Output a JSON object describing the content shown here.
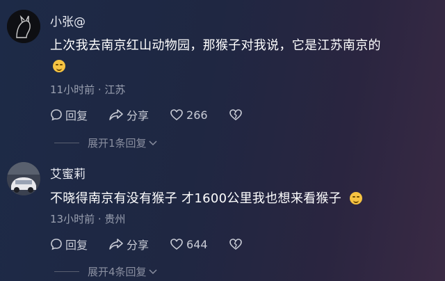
{
  "comments": [
    {
      "username": "小张@",
      "text": "上次我去南京红山动物园，那猴子对我说，它是江苏南京的",
      "time_location": "11小时前 · 江苏",
      "reply_label": "回复",
      "share_label": "分享",
      "like_count": "266",
      "expand_label": "展开1条回复"
    },
    {
      "username": "艾蜜莉",
      "text": "不晓得南京有没有猴子 才1600公里我也想来看猴子",
      "time_location": "13小时前 · 贵州",
      "reply_label": "回复",
      "share_label": "分享",
      "like_count": "644",
      "expand_label": "展开4条回复"
    }
  ],
  "colors": {
    "text": "#ffffff",
    "muted": "#9aa0b0",
    "emoji": "#f6c342"
  }
}
